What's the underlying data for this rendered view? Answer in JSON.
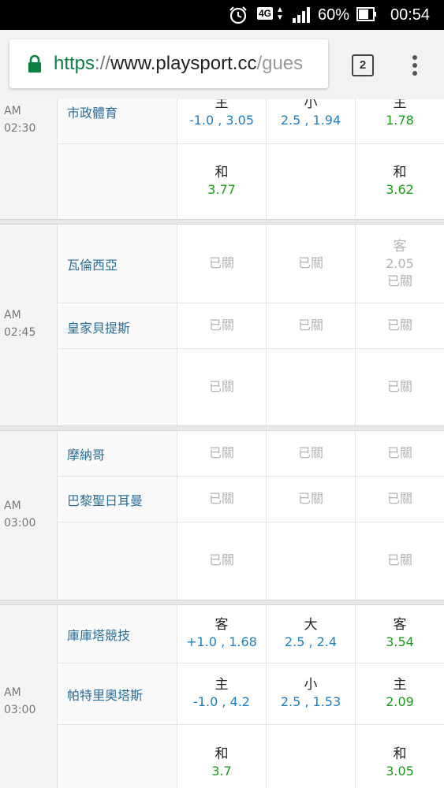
{
  "status_bar": {
    "network": "4G",
    "battery_percent": "60%",
    "time": "00:54",
    "icons": [
      "alarm-icon",
      "data-arrows-icon",
      "signal-icon",
      "battery-icon"
    ]
  },
  "browser": {
    "url_scheme": "https",
    "url_sep": "://",
    "url_host": "www.playsport.cc",
    "url_path": "/gues",
    "tab_count": "2",
    "colors": {
      "scheme": "#0b8043",
      "host": "#222222"
    }
  },
  "groups": [
    {
      "ampm": "AM",
      "time": "02:30",
      "rows": [
        {
          "team": "市政體育",
          "c1": {
            "label": "主",
            "line": "-1.0 , 3.05"
          },
          "c2": {
            "label": "小",
            "line": "2.5 , 1.94"
          },
          "c3": {
            "label": "主",
            "odds": "1.78"
          }
        },
        {
          "team": "",
          "c1": {
            "label": "和",
            "odds": "3.77"
          },
          "c2": {},
          "c3": {
            "label": "和",
            "odds": "3.62"
          }
        }
      ]
    },
    {
      "ampm": "AM",
      "time": "02:45",
      "rows": [
        {
          "team": "瓦倫西亞",
          "c1": {
            "closed": "已關"
          },
          "c2": {
            "closed": "已關"
          },
          "c3": {
            "label": "客",
            "odds": "2.05",
            "closed": "已關"
          }
        },
        {
          "team": "皇家貝提斯",
          "c1": {
            "closed": "已關"
          },
          "c2": {
            "closed": "已關"
          },
          "c3": {
            "closed": "已關"
          }
        },
        {
          "team": "",
          "c1": {
            "closed": "已關"
          },
          "c2": {},
          "c3": {
            "closed": "已關"
          }
        }
      ]
    },
    {
      "ampm": "AM",
      "time": "03:00",
      "rows": [
        {
          "team": "摩納哥",
          "c1": {
            "closed": "已關"
          },
          "c2": {
            "closed": "已關"
          },
          "c3": {
            "closed": "已關"
          }
        },
        {
          "team": "巴黎聖日耳曼",
          "c1": {
            "closed": "已關"
          },
          "c2": {
            "closed": "已關"
          },
          "c3": {
            "closed": "已關"
          }
        },
        {
          "team": "",
          "c1": {
            "closed": "已關"
          },
          "c2": {},
          "c3": {
            "closed": "已關"
          }
        }
      ]
    },
    {
      "ampm": "AM",
      "time": "03:00",
      "rows": [
        {
          "team": "庫庫塔競技",
          "c1": {
            "label": "客",
            "line": "+1.0 , 1.68"
          },
          "c2": {
            "label": "大",
            "line": "2.5 , 2.4"
          },
          "c3": {
            "label": "客",
            "odds": "3.54"
          }
        },
        {
          "team": "帕特里奧塔斯",
          "c1": {
            "label": "主",
            "line": "-1.0 , 4.2"
          },
          "c2": {
            "label": "小",
            "line": "2.5 , 1.53"
          },
          "c3": {
            "label": "主",
            "odds": "2.09"
          }
        },
        {
          "team": "",
          "c1": {
            "label": "和",
            "odds": "3.7"
          },
          "c2": {},
          "c3": {
            "label": "和",
            "odds": "3.05"
          }
        }
      ]
    }
  ],
  "colors": {
    "team_link": "#2a6e99",
    "handicap_line": "#1f7fc4",
    "odds": "#1a9a1a",
    "closed": "#b3b3b3"
  }
}
